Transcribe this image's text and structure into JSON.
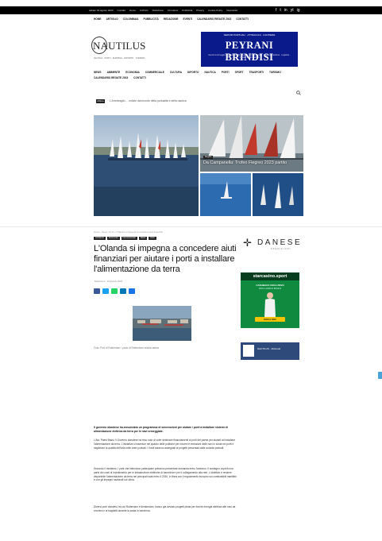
{
  "topbar": {
    "items": [
      "sabato 19 agosto 2023",
      "Contatti",
      "Home",
      "Archivio",
      "Redazione",
      "Chi siamo",
      "Pubblicità",
      "Privacy",
      "Cookie Policy",
      "Newsletter"
    ],
    "social": [
      "f",
      "t",
      "in",
      "yt",
      "ig"
    ]
  },
  "nav_primary": [
    "Home",
    "Artiglio",
    "Colombaia",
    "Pubblicità",
    "Redazione",
    "Eventi",
    "Calendario regate 2023",
    "Contatti"
  ],
  "logo": {
    "name": "NAUTILUS",
    "letter": "N",
    "tagline": "NAUTICA · PORTI · SHIPPING · DIPORTO · TURISMO"
  },
  "banner": {
    "top": "SERVIZI PORTUALI · ATTRACCHI · CANTIERE",
    "title": "PEYRANI BRINDISI",
    "desc": "Servizi di ormeggio e assistenza alle navi nel porto di Brindisi · Agenzia marittima · Logistica · Contatti e informazioni"
  },
  "nav_secondary": [
    "News",
    "Ambiente",
    "Economia",
    "Commerciale",
    "Cultura",
    "Diporto",
    "Nautica",
    "Porti",
    "Sport",
    "Trasporti",
    "Turismo",
    "Calendario regate 2023",
    "Contatti"
  ],
  "ticker": {
    "badge": "Ultime",
    "text": "L'Ammiraglio ... notizie dal mondo della portualità e della nautica"
  },
  "hero": {
    "tag": "Regate",
    "caption": "Da Campanella: Trofeo Flegreo 2023 partito"
  },
  "breadcrumb": "Home › News › Porti › L'Olanda si impegna a concedere aiuti finanziari",
  "categories": [
    "Ambiente",
    "Economia",
    "Internazionale",
    "News",
    "Porti"
  ],
  "article": {
    "title": "L'Olanda si impegna a concedere aiuti finanziari per aiutare i porti a installare l'alimentazione da terra",
    "meta": "Redazione · 19 agosto 2023",
    "caption": "Foto: Port of Rotterdam / porto di Rotterdam veduta aerea",
    "lead": "Il governo olandese ha annunciato un programma di sovvenzioni per aiutare i porti a installare sistemi di alimentazione elettrica da terra per le navi ormeggiate.",
    "paragraphs": [
      "L'Aia, Paesi Bassi. Il Governo olandese ha reso noto di voler destinare finanziamenti ai porti del paese per aiutarli ad installare l'alimentazione da terra. L'iniziativa si inserisce nel quadro delle politiche per ridurre le emissioni delle navi in sosta nei porti e migliorare la qualità dell'aria nelle aree portuali. I fondi saranno assegnati ai progetti presentati dalle autorità portuali.",
      "Secondo il ministero, i porti che intendono partecipare potranno presentare domanda entro l'autunno. Il sostegno coprirà una parte dei costi di investimento per le infrastrutture elettriche di banchina e per il collegamento alla rete. L'obiettivo è rendere disponibile l'alimentazione da terra nei principali scali entro il 2030, in linea con il regolamento europeo sui combustibili marittimi e con gli impegni nazionali sul clima.",
      "Diversi porti olandesi, tra cui Rotterdam e Amsterdam, hanno già avviato progetti pilota per fornire energia elettrica alle navi da crociera e ai traghetti durante la sosta in banchina."
    ]
  },
  "sidebar": {
    "danese": {
      "name": "DANESE",
      "sub": "SPEDIZIONI"
    },
    "starcasino": {
      "brand": "starcasino.sport",
      "line1": "CASHBACK ESCLUSIVO",
      "line2": "FINO A 200€ DI BONUS",
      "button": "GIOCA ORA"
    },
    "nautilus_ad": "NAUTILUS · Abbonati"
  },
  "colors": {
    "banner": "#0a1a8a",
    "starcasino": "#0f8a3e",
    "accent": "#4aa3d8"
  }
}
